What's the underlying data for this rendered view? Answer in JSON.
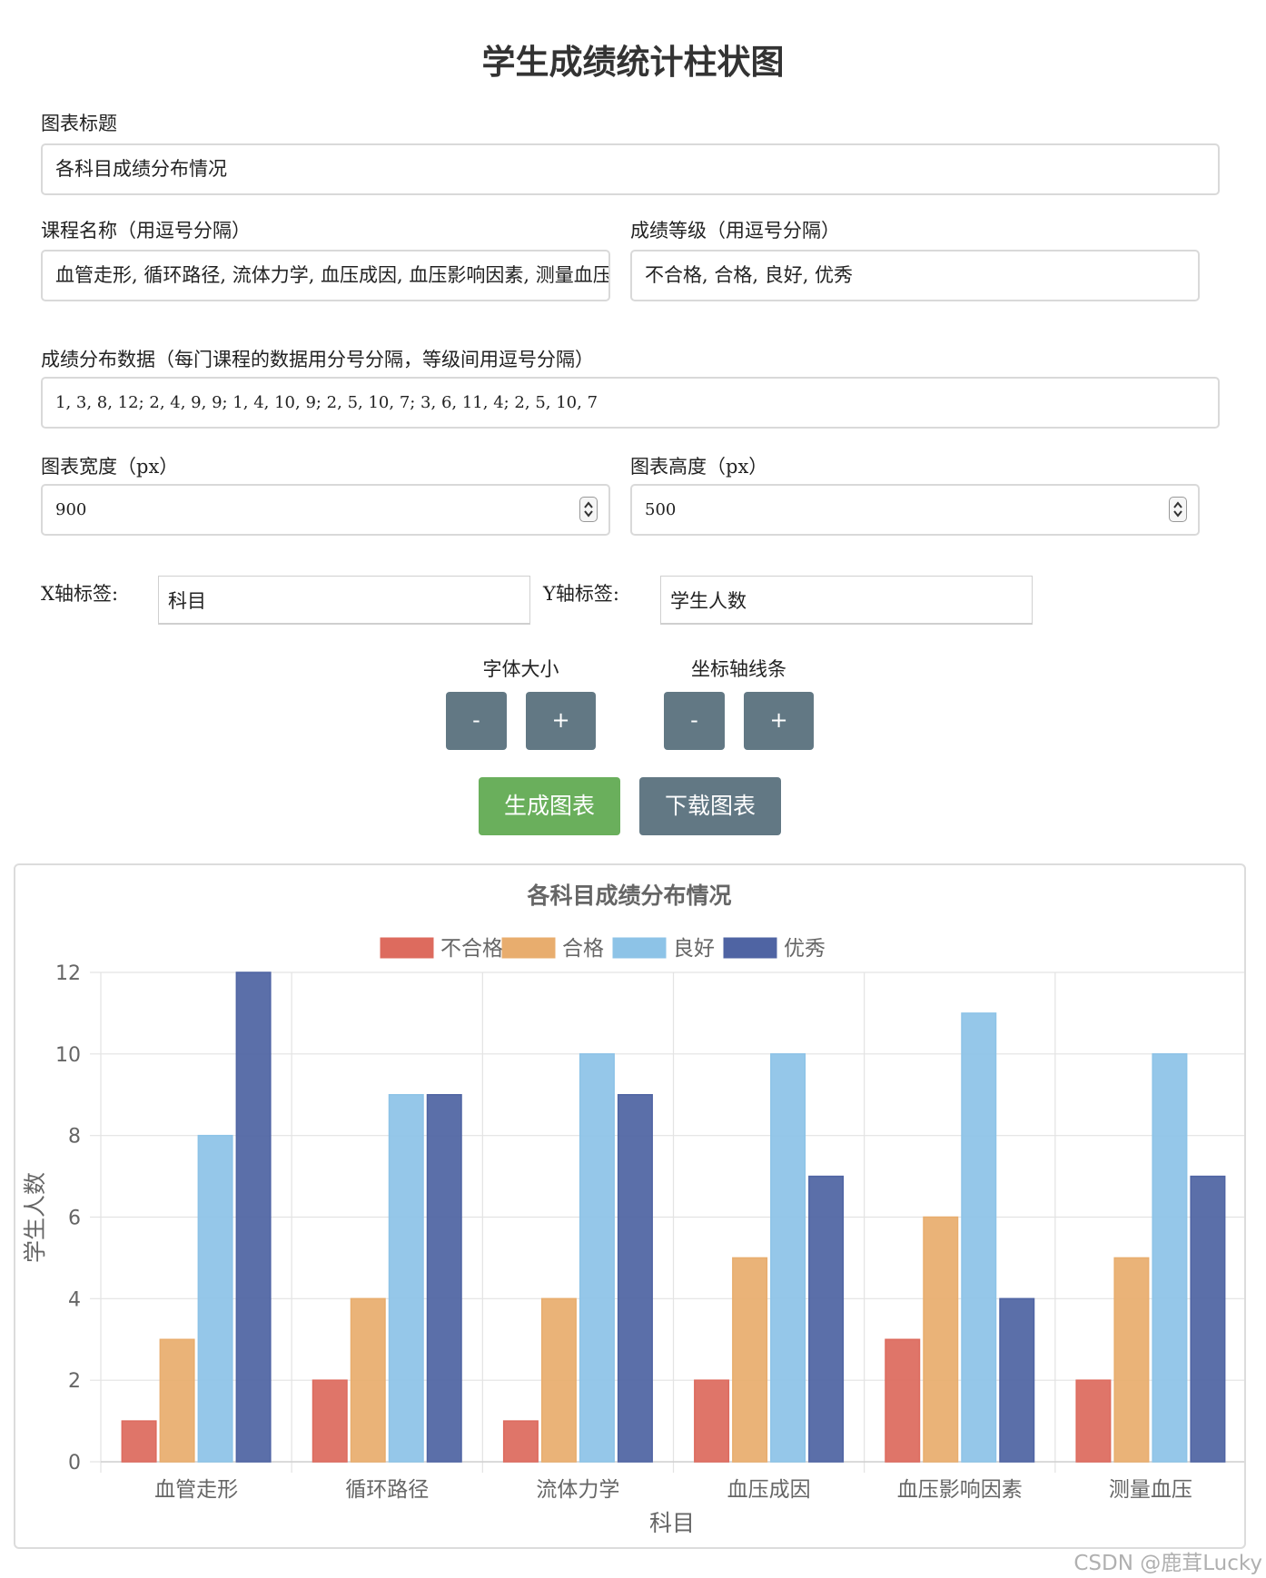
{
  "page": {
    "title": "学生成绩统计柱状图"
  },
  "form": {
    "chart_title_label": "图表标题",
    "chart_title_value": "各科目成绩分布情况",
    "courses_label": "课程名称（用逗号分隔）",
    "courses_value": "血管走形, 循环路径, 流体力学, 血压成因, 血压影响因素, 测量血压",
    "grades_label": "成绩等级（用逗号分隔）",
    "grades_value": "不合格, 合格, 良好, 优秀",
    "data_label": "成绩分布数据（每门课程的数据用分号分隔，等级间用逗号分隔）",
    "data_value": "1, 3, 8, 12; 2, 4, 9, 9; 1, 4, 10, 9; 2, 5, 10, 7; 3, 6, 11, 4; 2, 5, 10, 7",
    "width_label": "图表宽度（px）",
    "width_value": "900",
    "height_label": "图表高度（px）",
    "height_value": "500",
    "xaxis_label": "X轴标签:",
    "xaxis_value": "科目",
    "yaxis_label": "Y轴标签:",
    "yaxis_value": "学生人数"
  },
  "controls": {
    "font_size_label": "字体大小",
    "axis_line_label": "坐标轴线条",
    "minus": "-",
    "plus": "+",
    "generate_label": "生成图表",
    "download_label": "下载图表",
    "generate_color": "#6aaf5c",
    "download_color": "#627884"
  },
  "watermark": "CSDN @鹿茸Lucky",
  "chart_data": {
    "type": "bar",
    "title": "各科目成绩分布情况",
    "xlabel": "科目",
    "ylabel": "学生人数",
    "categories": [
      "血管走形",
      "循环路径",
      "流体力学",
      "血压成因",
      "血压影响因素",
      "测量血压"
    ],
    "series": [
      {
        "name": "不合格",
        "color": "#dd6b5e",
        "values": [
          1,
          2,
          1,
          2,
          3,
          2
        ]
      },
      {
        "name": "合格",
        "color": "#e8ad6e",
        "values": [
          3,
          4,
          4,
          5,
          6,
          5
        ]
      },
      {
        "name": "良好",
        "color": "#8dc3e7",
        "values": [
          8,
          9,
          10,
          10,
          11,
          10
        ]
      },
      {
        "name": "优秀",
        "color": "#4f64a3",
        "values": [
          12,
          9,
          9,
          7,
          4,
          7
        ]
      }
    ],
    "ylim": [
      0,
      12
    ],
    "yticks": [
      "0",
      "2",
      "4",
      "6",
      "8",
      "10",
      "12"
    ],
    "grid": true,
    "legend": "top-center"
  }
}
